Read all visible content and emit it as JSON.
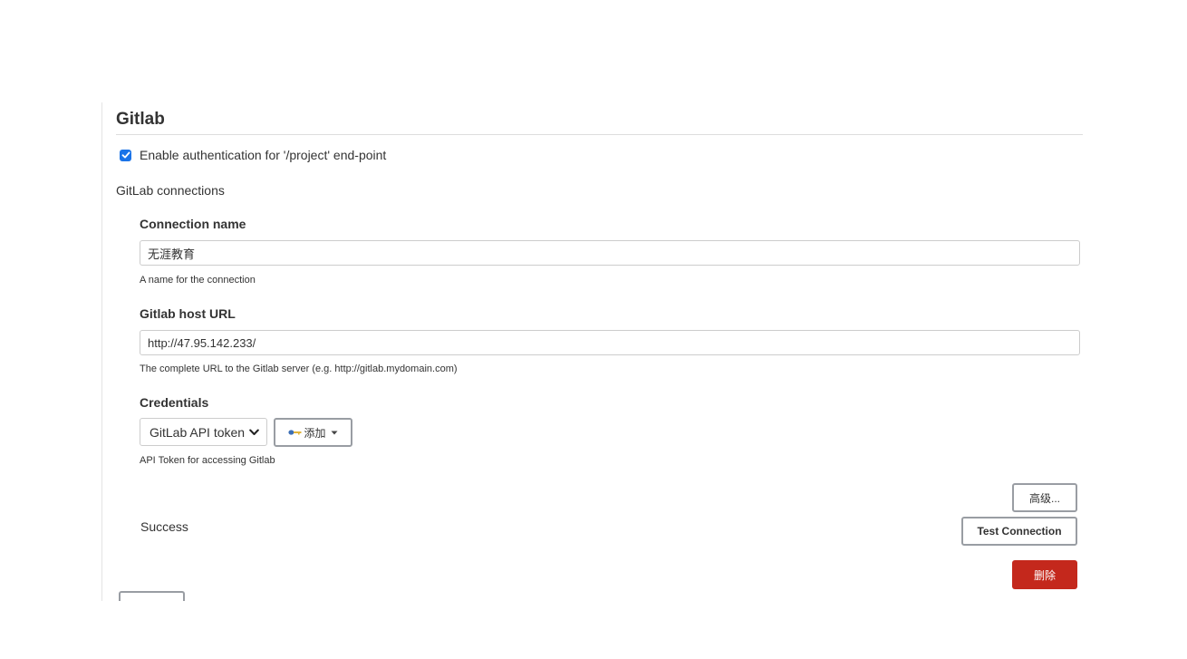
{
  "section": {
    "title": "Gitlab"
  },
  "auth_checkbox": {
    "label": "Enable authentication for '/project' end-point",
    "checked": true
  },
  "connections": {
    "group_label": "GitLab connections",
    "connection_name": {
      "label": "Connection name",
      "value": "无涯教育",
      "help": "A name for the connection"
    },
    "host_url": {
      "label": "Gitlab host URL",
      "value": "http://47.95.142.233/",
      "help": "The complete URL to the Gitlab server (e.g. http://gitlab.mydomain.com)"
    },
    "credentials": {
      "label": "Credentials",
      "selected": "GitLab API token",
      "add_label": "添加",
      "help": "API Token for accessing Gitlab"
    },
    "advanced_label": "高级...",
    "status": "Success",
    "test_label": "Test Connection",
    "delete_label": "删除"
  },
  "colors": {
    "checkbox": "#1a73e8",
    "delete_button": "#c4281c",
    "button_border": "#999da3"
  },
  "icons": {
    "key": "key-icon",
    "caret": "caret-down-icon",
    "select_chevron": "chevron-down-icon",
    "check": "checkmark-icon"
  }
}
